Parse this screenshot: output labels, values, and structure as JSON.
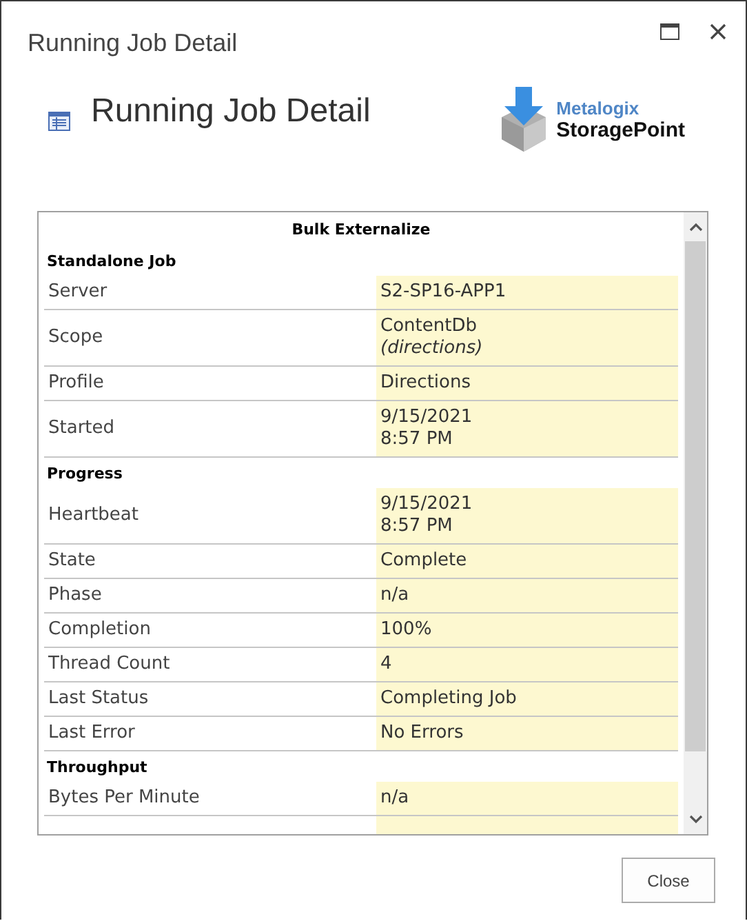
{
  "window": {
    "title": "Running Job Detail"
  },
  "header": {
    "title": "Running Job Detail",
    "logo": {
      "brand": "Metalogix",
      "product": "StoragePoint"
    }
  },
  "detail": {
    "title": "Bulk Externalize",
    "sections": [
      {
        "title": "Standalone Job",
        "rows": [
          {
            "label": "Server",
            "value": "S2-SP16-APP1"
          },
          {
            "label": "Scope",
            "value": "ContentDb\n*(directions)*"
          },
          {
            "label": "Profile",
            "value": "Directions"
          },
          {
            "label": "Started",
            "value": "9/15/2021\n8:57 PM"
          }
        ]
      },
      {
        "title": "Progress",
        "rows": [
          {
            "label": "Heartbeat",
            "value": "9/15/2021\n8:57 PM"
          },
          {
            "label": "State",
            "value": "Complete"
          },
          {
            "label": "Phase",
            "value": "n/a"
          },
          {
            "label": "Completion",
            "value": "100%"
          },
          {
            "label": "Thread Count",
            "value": "4"
          },
          {
            "label": "Last Status",
            "value": "Completing Job"
          },
          {
            "label": "Last Error",
            "value": "No Errors"
          }
        ]
      },
      {
        "title": "Throughput",
        "rows": [
          {
            "label": "Bytes Per Minute",
            "value": "n/a"
          }
        ]
      }
    ]
  },
  "buttons": [
    {
      "label": "Close"
    }
  ]
}
